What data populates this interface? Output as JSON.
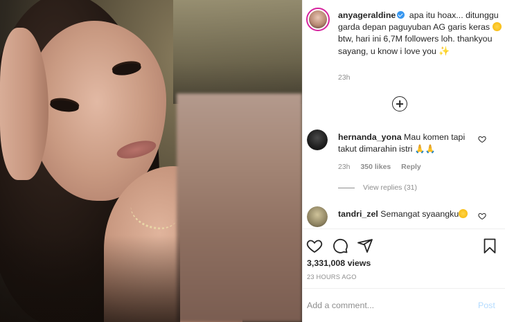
{
  "photo": {
    "alt_subject": "selfie"
  },
  "caption": {
    "username": "anyageraldine",
    "text_part1": "apa itu hoax... ditunggu garda depan paguyuban AG garis keras",
    "text_part2": "btw, hari ini 6,7M followers loh. thankyou sayang, u know i love you",
    "emoji1": "smiling-face-with-hearts",
    "emoji2": "sparkles",
    "time": "23h"
  },
  "load_more_icon": "plus-circle-icon",
  "comments": [
    {
      "username": "hernanda_yona",
      "text": "Mau komen tapi takut dimarahin istri",
      "emoji": "🙏🙏",
      "time": "23h",
      "likes": "350 likes",
      "reply_label": "Reply",
      "view_replies": "View replies (31)"
    },
    {
      "username": "tandri_zel",
      "text": "Semangat syaangku",
      "emoji": "smiling-face-with-heart-eyes"
    }
  ],
  "actions": {
    "like_icon": "heart-icon",
    "comment_icon": "comment-icon",
    "share_icon": "paper-plane-icon",
    "save_icon": "bookmark-icon"
  },
  "views": "3,331,008 views",
  "posted": "23 HOURS AGO",
  "comment_box": {
    "placeholder": "Add a comment...",
    "post_label": "Post"
  },
  "colors": {
    "verified": "#3897f0",
    "muted_text": "#8e8e8e",
    "post_disabled": "#b3dbff",
    "story_ring": "#d6249f"
  }
}
